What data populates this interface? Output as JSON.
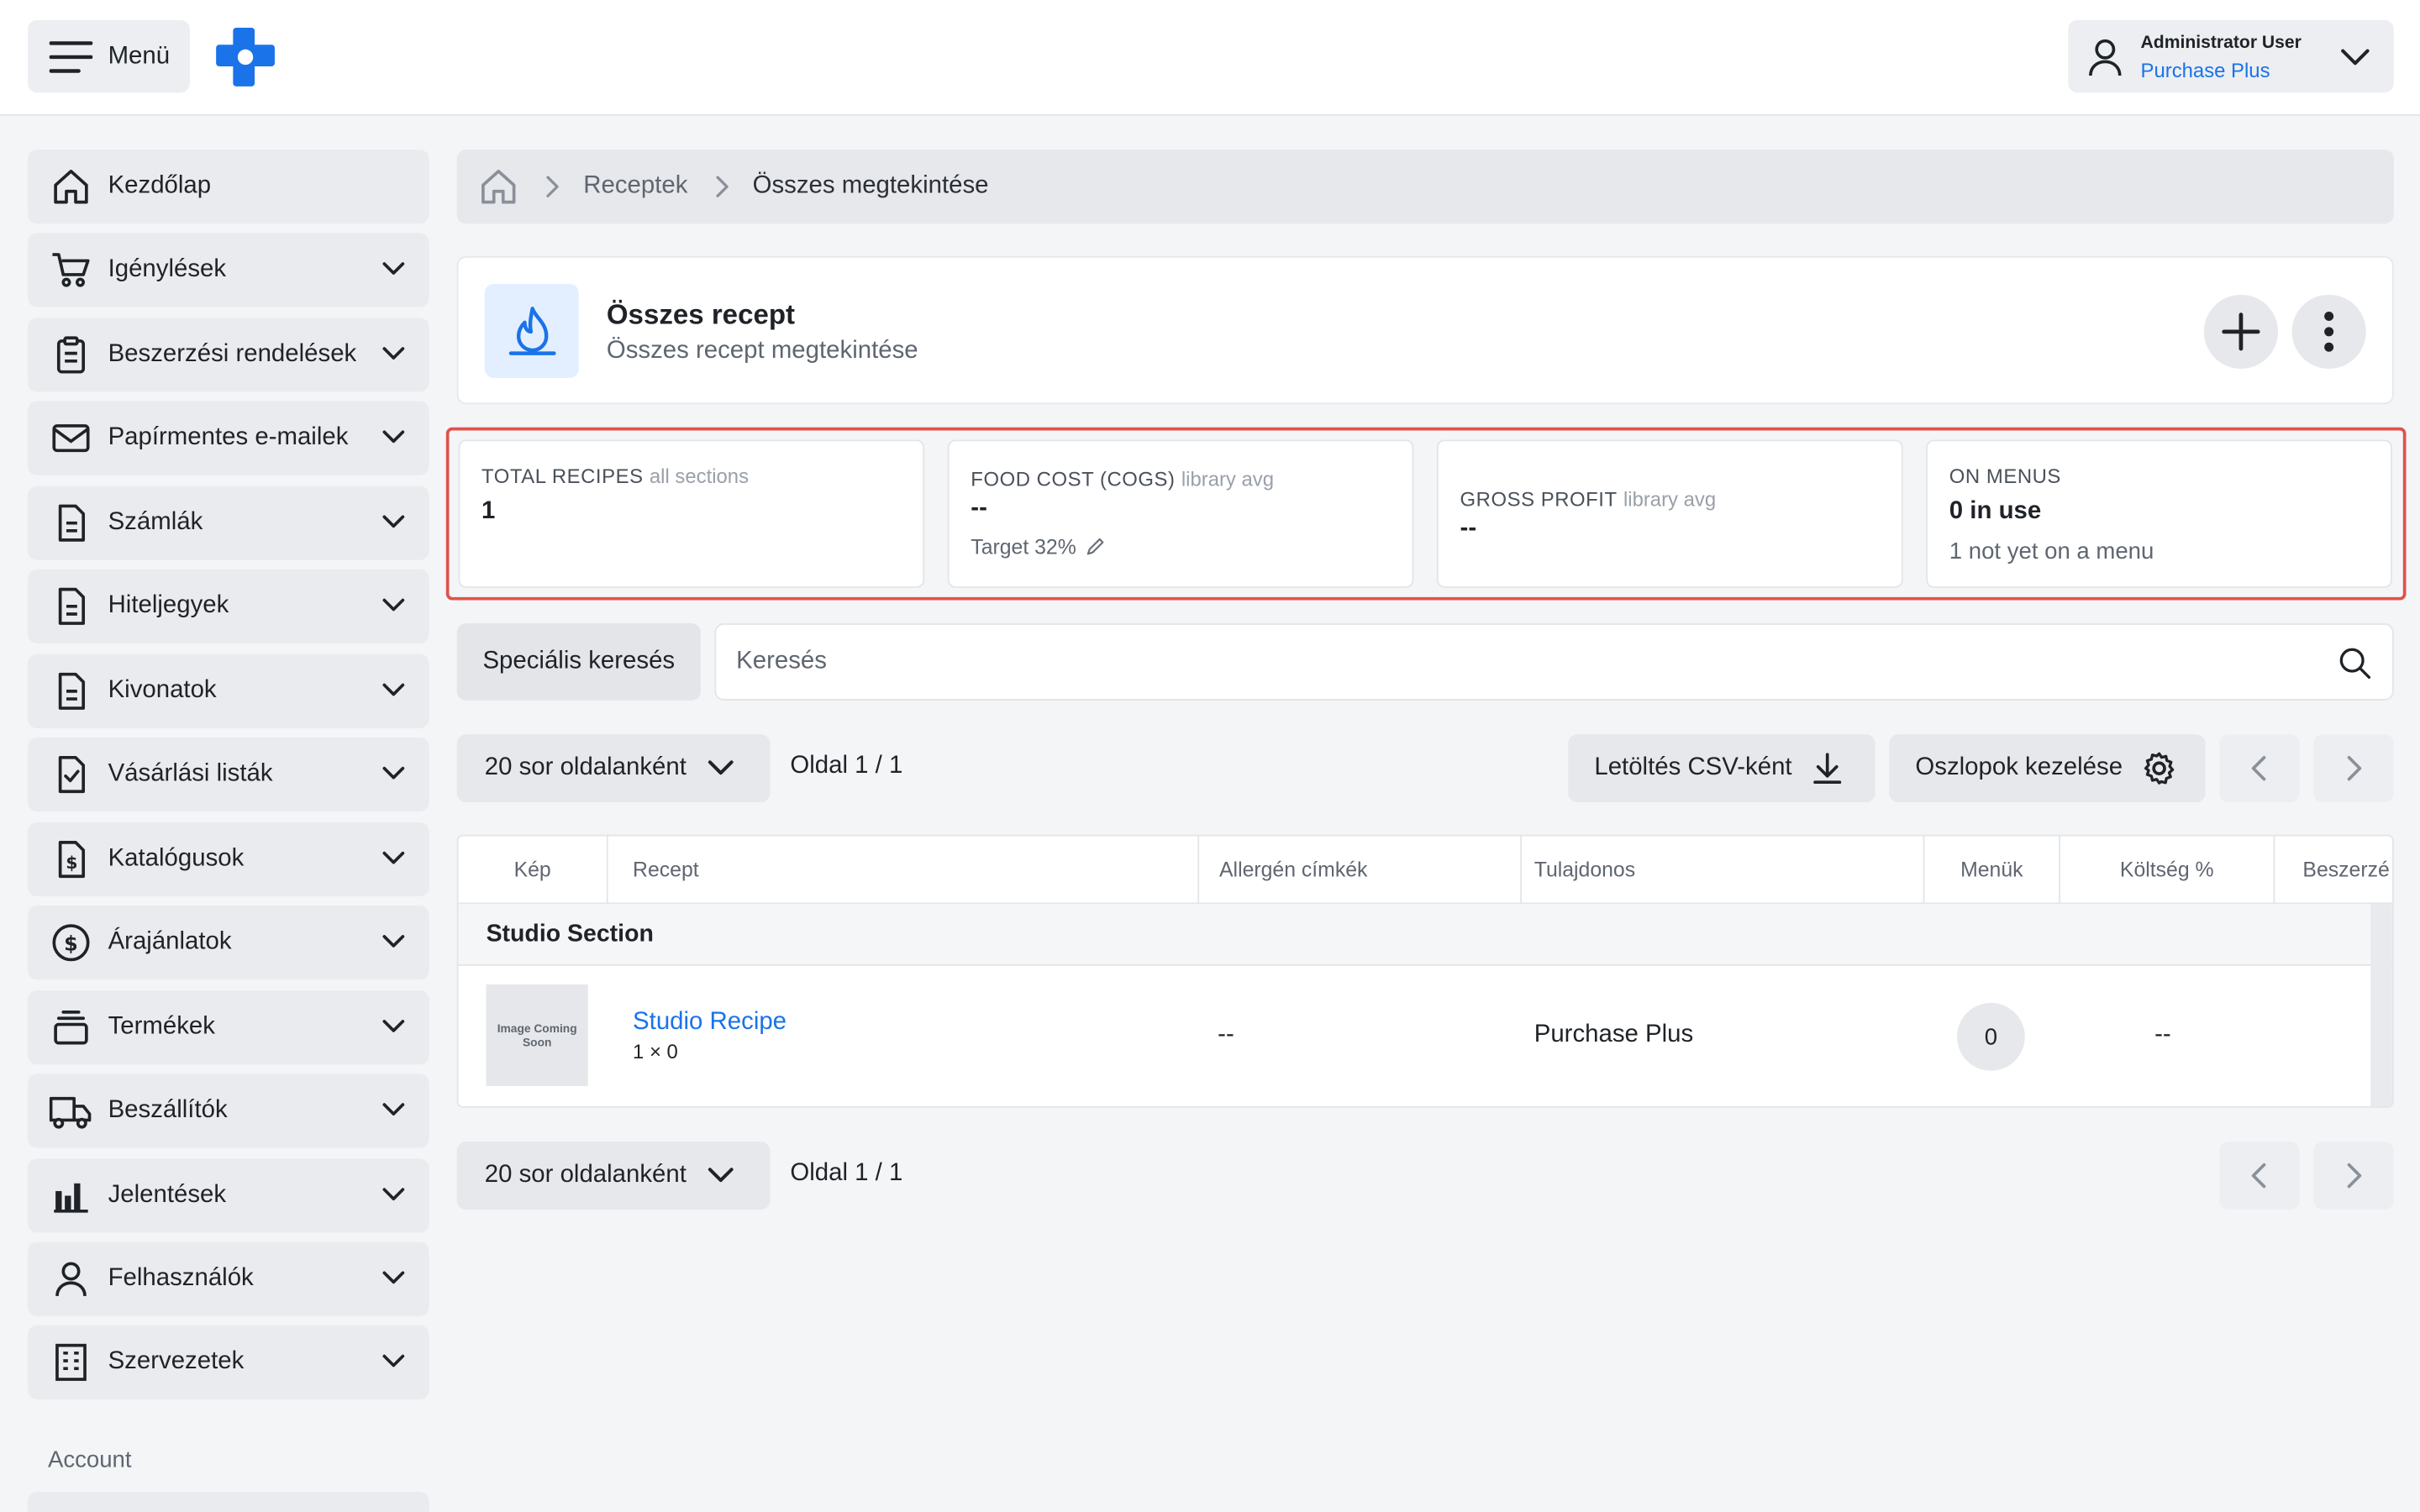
{
  "header": {
    "menu_label": "Menü",
    "user_name": "Administrator User",
    "user_org": "Purchase Plus"
  },
  "sidebar": {
    "items": [
      {
        "label": "Kezdőlap",
        "icon": "home-icon"
      },
      {
        "label": "Igénylések",
        "icon": "cart-icon"
      },
      {
        "label": "Beszerzési rendelések",
        "icon": "clipboard-icon"
      },
      {
        "label": "Papírmentes e-mailek",
        "icon": "mail-icon"
      },
      {
        "label": "Számlák",
        "icon": "document-icon"
      },
      {
        "label": "Hiteljegyek",
        "icon": "document-icon"
      },
      {
        "label": "Kivonatok",
        "icon": "document-icon"
      },
      {
        "label": "Vásárlási listák",
        "icon": "checklist-icon"
      },
      {
        "label": "Katalógusok",
        "icon": "catalog-icon"
      },
      {
        "label": "Árajánlatok",
        "icon": "dollar-circle-icon"
      },
      {
        "label": "Termékek",
        "icon": "products-icon"
      },
      {
        "label": "Beszállítók",
        "icon": "truck-icon"
      },
      {
        "label": "Jelentések",
        "icon": "chart-icon"
      },
      {
        "label": "Felhasználók",
        "icon": "user-icon"
      },
      {
        "label": "Szervezetek",
        "icon": "building-icon"
      }
    ],
    "account_label": "Account"
  },
  "breadcrumb": {
    "items": [
      "Receptek",
      "Összes megtekintése"
    ]
  },
  "page": {
    "title": "Összes recept",
    "subtitle": "Összes recept megtekintése"
  },
  "stats": {
    "total_recipes": {
      "label": "TOTAL RECIPES",
      "qualifier": "all sections",
      "value": "1"
    },
    "food_cost": {
      "label": "FOOD COST (COGS)",
      "qualifier": "library avg",
      "value": "--",
      "note": "Target 32%"
    },
    "gross_profit": {
      "label": "GROSS PROFIT",
      "qualifier": "library avg",
      "value": "--"
    },
    "on_menus": {
      "label": "ON MENUS",
      "value": "0 in use",
      "note": "1 not yet on a menu"
    }
  },
  "search": {
    "advanced_label": "Speciális keresés",
    "placeholder": "Keresés"
  },
  "toolbar": {
    "rows_per_page": "20 sor oldalanként",
    "page_info": "Oldal 1 / 1",
    "download_csv": "Letöltés CSV-ként",
    "manage_columns": "Oszlopok kezelése"
  },
  "table": {
    "columns": [
      "Kép",
      "Recept",
      "Allergén címkék",
      "Tulajdonos",
      "Menük",
      "Költség %",
      "Beszerzé"
    ],
    "section": "Studio Section",
    "image_placeholder": "Image Coming Soon",
    "rows": [
      {
        "recipe": "Studio Recipe",
        "qty": "1 × 0",
        "allergens": "--",
        "owner": "Purchase Plus",
        "menus": "0",
        "cost": "--"
      }
    ]
  },
  "colors": {
    "accent": "#1a73e8",
    "highlight_outline": "#e0524a",
    "logo": "#1a73e8"
  }
}
